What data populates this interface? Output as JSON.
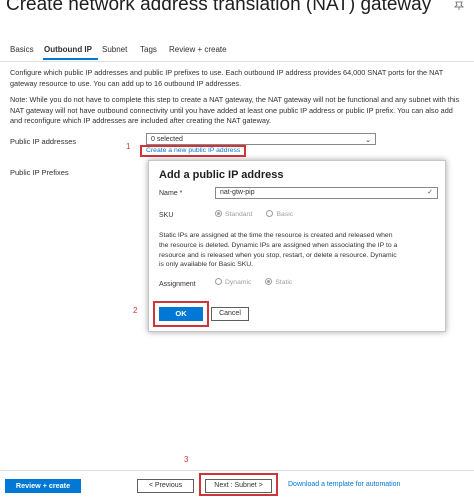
{
  "page": {
    "title": "Create network address translation (NAT) gateway"
  },
  "icons": {
    "pin": "pin-icon",
    "dropdown": "chevron-down-icon",
    "valid": "checkmark-icon"
  },
  "tabs": [
    {
      "label": "Basics"
    },
    {
      "label": "Outbound IP"
    },
    {
      "label": "Subnet"
    },
    {
      "label": "Tags"
    },
    {
      "label": "Review + create"
    }
  ],
  "intro": "Configure which public IP addresses and public IP prefixes to use. Each outbound IP address provides 64,000 SNAT ports for the NAT gateway resource to use. You can add up to 16 outbound IP addresses.",
  "note": "Note: While you do not have to complete this step to create a NAT gateway, the NAT gateway will not be functional and any subnet with this NAT gateway will not have outbound connectivity until you have added at least one public IP address or public IP prefix. You can also add and reconfigure which IP addresses are included after creating the NAT gateway.",
  "form": {
    "public_ip_label": "Public IP addresses",
    "public_ip_value": "0 selected",
    "create_link": "Create a new public IP address",
    "public_prefix_label": "Public IP Prefixes"
  },
  "callouts": {
    "one": "1",
    "two": "2",
    "three": "3"
  },
  "modal": {
    "title": "Add a public IP address",
    "name_label": "Name *",
    "name_value": "nat-gtw-pip",
    "sku_label": "SKU",
    "sku_options": [
      "Standard",
      "Basic"
    ],
    "sku_selected": "Standard",
    "description": "Static IPs are assigned at the time the resource is created and released when the resource is deleted. Dynamic IPs are assigned when associating the IP to a resource and is released when you stop, restart, or delete a resource. Dynamic is only available for Basic SKU.",
    "assignment_label": "Assignment",
    "assignment_options": [
      "Dynamic",
      "Static"
    ],
    "assignment_selected": "Static",
    "ok_label": "OK",
    "cancel_label": "Cancel"
  },
  "footer": {
    "review_label": "Review + create",
    "prev_label": "< Previous",
    "next_label": "Next : Subnet >",
    "download_label": "Download a template for automation"
  },
  "colors": {
    "accent": "#0078d4",
    "highlight": "#d13438"
  }
}
